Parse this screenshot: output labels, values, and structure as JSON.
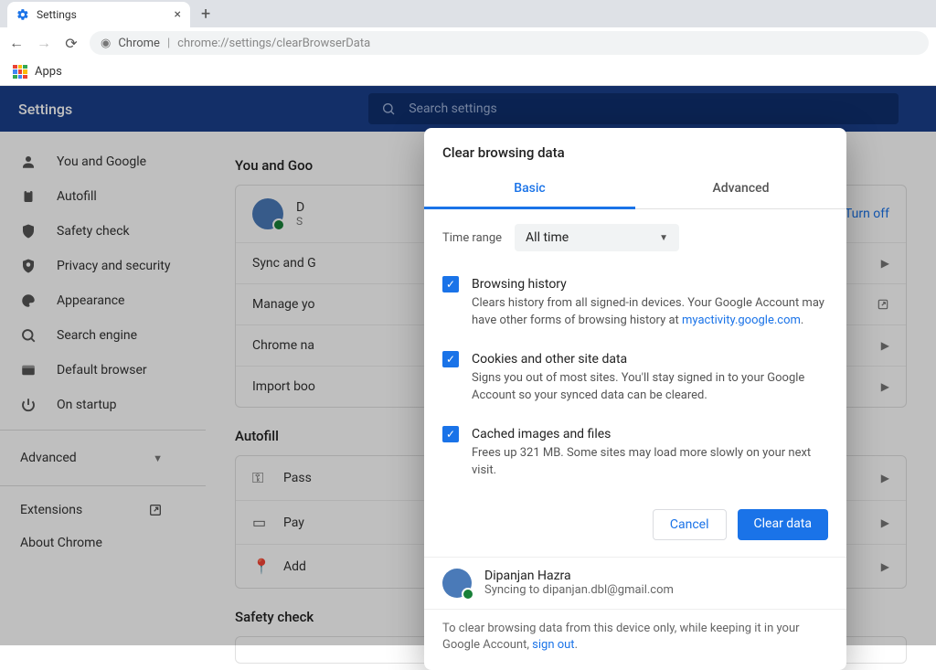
{
  "tab": {
    "title": "Settings"
  },
  "omnibox": {
    "app": "Chrome",
    "url_main": "chrome://settings/",
    "url_tail": "clearBrowserData"
  },
  "bookmarks": {
    "apps": "Apps"
  },
  "settings_header": {
    "title": "Settings",
    "search_placeholder": "Search settings"
  },
  "sidebar": {
    "items": [
      {
        "label": "You and Google"
      },
      {
        "label": "Autofill"
      },
      {
        "label": "Safety check"
      },
      {
        "label": "Privacy and security"
      },
      {
        "label": "Appearance"
      },
      {
        "label": "Search engine"
      },
      {
        "label": "Default browser"
      },
      {
        "label": "On startup"
      }
    ],
    "advanced": "Advanced",
    "extensions": "Extensions",
    "about": "About Chrome"
  },
  "main": {
    "section1": "You and Goo",
    "acct_initial": "D",
    "acct_sub": "S",
    "turn_off": "Turn off",
    "rows": [
      "Sync and G",
      "Manage yo",
      "Chrome na",
      "Import boo"
    ],
    "section2": "Autofill",
    "autofill_rows": [
      "Pass",
      "Pay",
      "Add"
    ],
    "section3": "Safety check"
  },
  "modal": {
    "title": "Clear browsing data",
    "tab_basic": "Basic",
    "tab_advanced": "Advanced",
    "time_range_label": "Time range",
    "time_range_value": "All time",
    "opts": {
      "history_title": "Browsing history",
      "history_desc_a": "Clears history from all signed-in devices. Your Google Account may have other forms of browsing history at ",
      "history_link": "myactivity.google.com",
      "cookies_title": "Cookies and other site data",
      "cookies_desc": "Signs you out of most sites. You'll stay signed in to your Google Account so your synced data can be cleared.",
      "cache_title": "Cached images and files",
      "cache_desc": "Frees up 321 MB. Some sites may load more slowly on your next visit."
    },
    "cancel": "Cancel",
    "clear": "Clear data",
    "profile_name": "Dipanjan Hazra",
    "profile_sync": "Syncing to dipanjan.dbl@gmail.com",
    "footer_a": "To clear browsing data from this device only, while keeping it in your Google Account, ",
    "footer_link": "sign out"
  }
}
